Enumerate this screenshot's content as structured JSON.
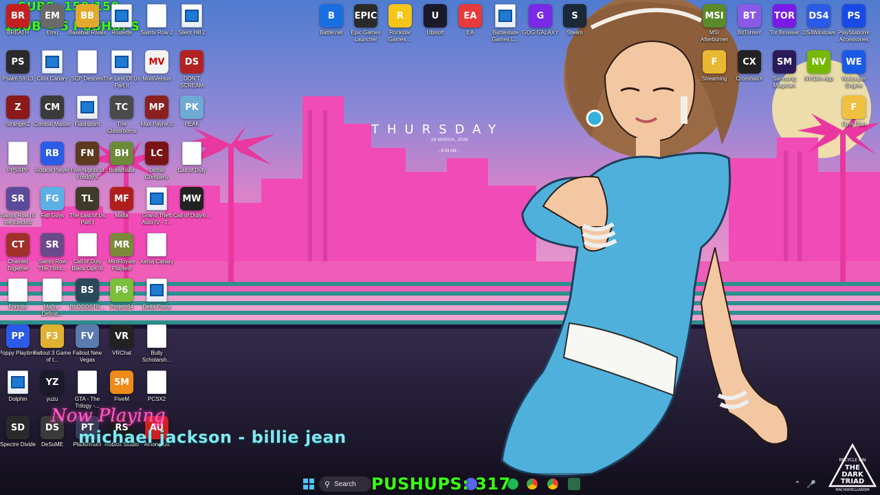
{
  "overlay": {
    "subs_counter": "SUBS: 150/150",
    "pushup_rule": "1SUB = 5 PUSHUPS",
    "pushups_counter": "PUSHUPS: 317",
    "now_playing_label": "Now Playing",
    "now_playing_track": "michael jackson - billie jean"
  },
  "clock_widget": {
    "day": "THURSDAY",
    "date": "26 MARCH, 2026.",
    "time": "- 8:33 AM -"
  },
  "desktop_icons_left": [
    {
      "label": "BREATH"
    },
    {
      "label": "Emu"
    },
    {
      "label": "Baseball Rivals"
    },
    {
      "label": "Roulette"
    },
    {
      "label": "Saints Row 2"
    },
    {
      "label": "Silent Hill 2"
    },
    {
      "label": "Psalm 59-13"
    },
    {
      "label": "Citra Canary"
    },
    {
      "label": "SCP Descent"
    },
    {
      "label": "The Last Of Us Part II"
    },
    {
      "label": "MultiVersus"
    },
    {
      "label": "DON'T SCREAM"
    },
    {
      "label": "StrangerZ"
    },
    {
      "label": "Combat Master"
    },
    {
      "label": "Flashpoint"
    },
    {
      "label": "The Classrooms"
    },
    {
      "label": "Max Payne 3"
    },
    {
      "label": "PEAK"
    },
    {
      "label": "PPSSPP"
    },
    {
      "label": "Roblox Player"
    },
    {
      "label": "Five Nights at Freddy's"
    },
    {
      "label": "Brawlhalla"
    },
    {
      "label": "Lethal Company"
    },
    {
      "label": "Call of Duty"
    },
    {
      "label": "Saints Row IV Re-Elected"
    },
    {
      "label": "Fall Guys"
    },
    {
      "label": "The Last of Us Part I"
    },
    {
      "label": "Mafia"
    },
    {
      "label": "Grand Theft Auto IV - T..."
    },
    {
      "label": "Call of Duty®..."
    },
    {
      "label": "Chained Together"
    },
    {
      "label": "Saints Row The Third..."
    },
    {
      "label": "Call of Duty Black Ops III"
    },
    {
      "label": "MiniRoyale Playtest"
    },
    {
      "label": "Xenia Canary"
    },
    {
      "label": "Fortnite"
    },
    {
      "label": "Mafia - Definiti..."
    },
    {
      "label": "BLOODSTR..."
    },
    {
      "label": "Project64"
    },
    {
      "label": "Delta Force"
    },
    {
      "label": "Poppy Playtime"
    },
    {
      "label": "Fallout 3 Game of t..."
    },
    {
      "label": "Fallout New Vegas"
    },
    {
      "label": "VRChat"
    },
    {
      "label": "Bully Scholarsh..."
    },
    {
      "label": "Dolphin"
    },
    {
      "label": "yuzu"
    },
    {
      "label": "GTA - The Trilogy -..."
    },
    {
      "label": "FiveM"
    },
    {
      "label": "PCSX2"
    },
    {
      "label": "Spectre Divide"
    },
    {
      "label": "DeSuME"
    },
    {
      "label": "Platformum"
    },
    {
      "label": "Roblox Studio"
    },
    {
      "label": "Among Us"
    }
  ],
  "desktop_icons_top": [
    {
      "label": "Battle.net"
    },
    {
      "label": "Epic Games Launcher"
    },
    {
      "label": "Rockstar Games ..."
    },
    {
      "label": "Ubisoft"
    },
    {
      "label": "EA"
    },
    {
      "label": "Battlestate Games L..."
    },
    {
      "label": "GOG GALAXY"
    },
    {
      "label": "Steam"
    }
  ],
  "desktop_icons_right": [
    {
      "label": "MSI Afterburner"
    },
    {
      "label": "BitTorrent"
    },
    {
      "label": "Tor Browser"
    },
    {
      "label": "DS4Windows"
    },
    {
      "label": "PlayStation® Accessories"
    },
    {
      "label": "Streaming"
    },
    {
      "label": "CrosshairX"
    },
    {
      "label": "Samsung Magician"
    },
    {
      "label": "NVIDIA App"
    },
    {
      "label": "Wallpaper Engine"
    },
    {
      "label": "Gym Plan"
    }
  ],
  "taskbar": {
    "search_label": "Search"
  },
  "watermark": {
    "line1": "RECYCLE BIN",
    "line2": "THE",
    "line3": "DARK",
    "line4": "TRIAD",
    "line5": "MACHIAVELLIANISM"
  },
  "colors": {
    "overlay_green": "#39ff14",
    "now_playing_pink": "#ff5fc8",
    "track_cyan": "#7fe7ee",
    "sky_top": "#5a8fd8",
    "sky_bottom": "#d96bc6",
    "city_pink": "#f04ab8",
    "dress_blue": "#4fb0dc"
  }
}
